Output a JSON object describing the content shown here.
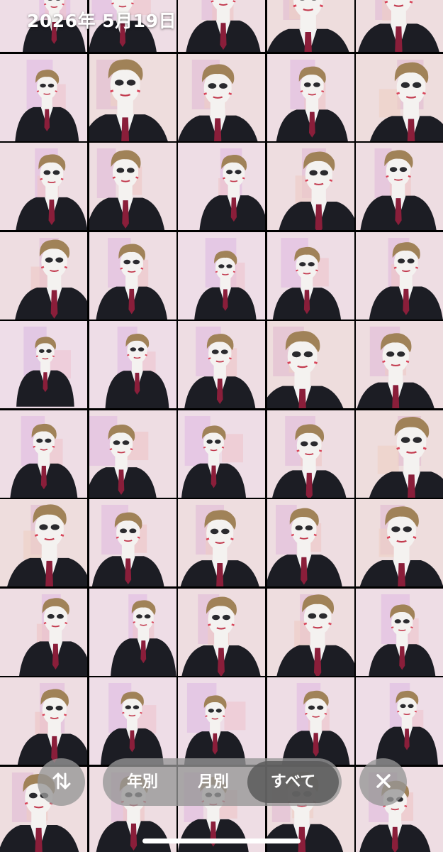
{
  "header": {
    "date": "2026年 5月19日"
  },
  "bottom_bar": {
    "sort_icon": "sort-arrows-icon",
    "segments": [
      {
        "label": "年別",
        "selected": false
      },
      {
        "label": "月別",
        "selected": false
      },
      {
        "label": "すべて",
        "selected": true
      }
    ],
    "close_icon": "close-icon"
  },
  "grid": {
    "columns": 5,
    "thumbnail_count": 50
  },
  "colors": {
    "thumbnail_background": "#efe6ea",
    "suit": "#1c1d24",
    "tie": "#8a1e3a",
    "hair": "#a08258",
    "face": "#f4f2f0",
    "control_background": "#969696",
    "selected_segment": "#5a5a5a"
  }
}
